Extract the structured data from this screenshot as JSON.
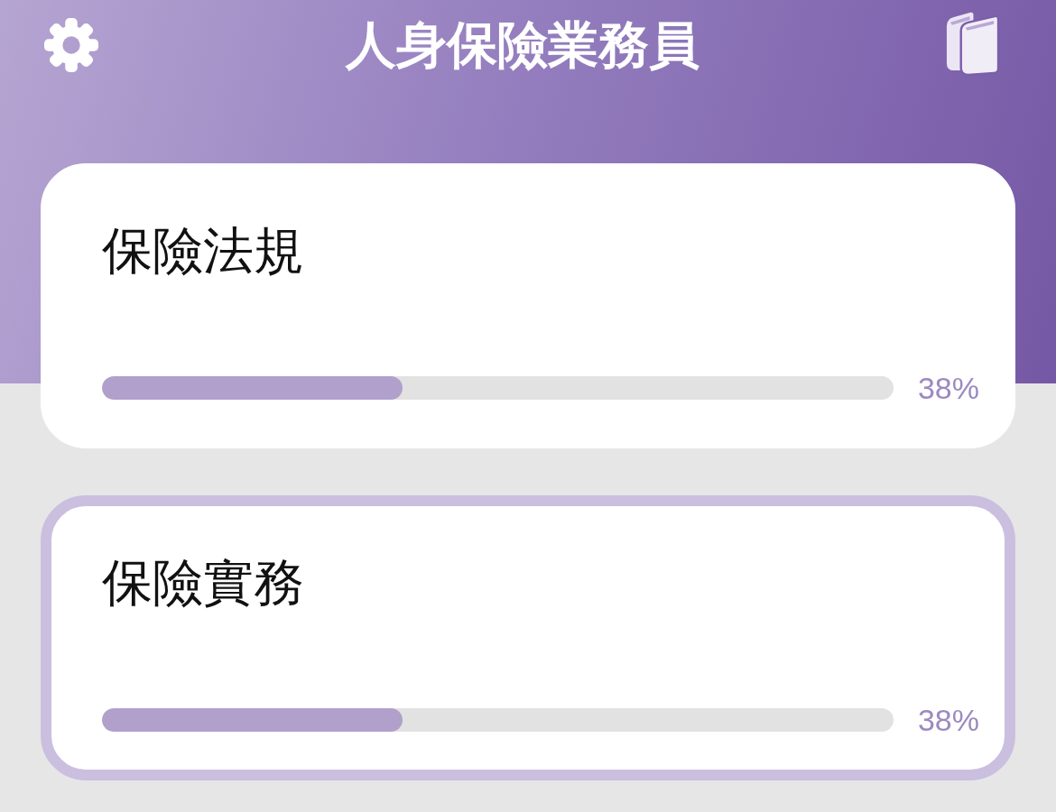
{
  "header": {
    "title": "人身保險業務員"
  },
  "subjects": [
    {
      "name": "保險法規",
      "level": 0.38,
      "reading": "38%",
      "selected": false
    },
    {
      "name": "保險實務",
      "level": 0.38,
      "reading": "38%",
      "selected": true
    }
  ]
}
